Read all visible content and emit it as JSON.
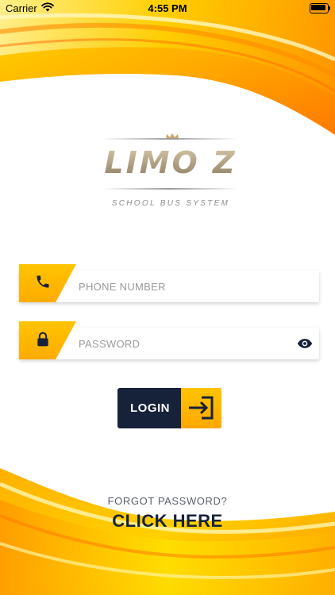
{
  "status_bar": {
    "carrier": "Carrier",
    "time": "4:55 PM"
  },
  "logo": {
    "name": "LIMO Z",
    "tagline": "SCHOOL BUS SYSTEM"
  },
  "form": {
    "phone_placeholder": "PHONE NUMBER",
    "password_placeholder": "PASSWORD"
  },
  "login_button": {
    "label": "LOGIN"
  },
  "footer": {
    "forgot_text": "FORGOT PASSWORD?",
    "click_here": "CLICK HERE"
  },
  "colors": {
    "accent_yellow": "#ffb800",
    "navy": "#16213a",
    "gold": "#b5a48a"
  },
  "icons": [
    "wifi-icon",
    "battery-icon",
    "phone-icon",
    "lock-icon",
    "eye-icon",
    "login-arrow-icon",
    "crown-icon"
  ]
}
